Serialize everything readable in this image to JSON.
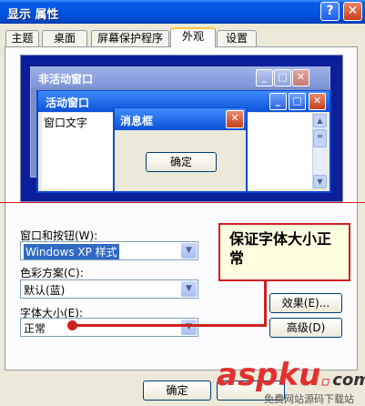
{
  "window": {
    "title": "显示 属性",
    "help_glyph": "?",
    "close_glyph": "✕"
  },
  "tabs": [
    {
      "label": "主题",
      "active": false
    },
    {
      "label": "桌面",
      "active": false
    },
    {
      "label": "屏幕保护程序",
      "active": false
    },
    {
      "label": "外观",
      "active": true
    },
    {
      "label": "设置",
      "active": false
    }
  ],
  "preview": {
    "inactive_title": "非活动窗口",
    "active_title": "活动窗口",
    "window_text": "窗口文字",
    "message_title": "消息框",
    "ok_label": "确定"
  },
  "form": {
    "window_buttons_label": "窗口和按钮(W):",
    "window_buttons_value": "Windows XP 样式",
    "color_scheme_label": "色彩方案(C):",
    "color_scheme_value": "默认(蓝)",
    "font_size_label": "字体大小(E):",
    "font_size_value": "正常",
    "effects_label": "效果(E)...",
    "advanced_label": "高级(D)"
  },
  "callout": {
    "text": "保证字体大小正常"
  },
  "footer": {
    "ok_label": "确定"
  },
  "watermark": {
    "brand_a": "asp",
    "brand_b": "ku",
    "dot": ".",
    "tld": "com",
    "subtitle": "免费网站源码下载站"
  },
  "colors": {
    "accent_red": "#d02020",
    "title_blue": "#0055e5",
    "dialog_bg": "#ece9d8"
  }
}
